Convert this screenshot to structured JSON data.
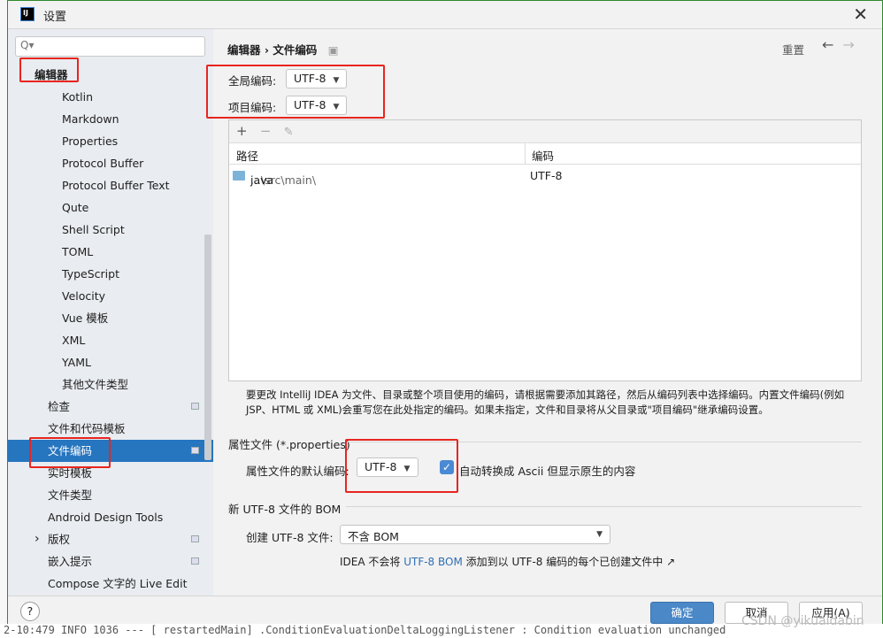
{
  "window": {
    "title": "设置",
    "logo": "IJ"
  },
  "sidebar": {
    "search_placeholder": "Q▾",
    "items": [
      {
        "label": "编辑器",
        "level": 0
      },
      {
        "label": "Kotlin",
        "level": 2
      },
      {
        "label": "Markdown",
        "level": 2
      },
      {
        "label": "Properties",
        "level": 2
      },
      {
        "label": "Protocol Buffer",
        "level": 2
      },
      {
        "label": "Protocol Buffer Text",
        "level": 2
      },
      {
        "label": "Qute",
        "level": 2
      },
      {
        "label": "Shell Script",
        "level": 2
      },
      {
        "label": "TOML",
        "level": 2
      },
      {
        "label": "TypeScript",
        "level": 2
      },
      {
        "label": "Velocity",
        "level": 2
      },
      {
        "label": "Vue 模板",
        "level": 2
      },
      {
        "label": "XML",
        "level": 2
      },
      {
        "label": "YAML",
        "level": 2
      },
      {
        "label": "其他文件类型",
        "level": 2
      },
      {
        "label": "检查",
        "level": 1
      },
      {
        "label": "文件和代码模板",
        "level": 1
      },
      {
        "label": "文件编码",
        "level": 1,
        "selected": true
      },
      {
        "label": "实时模板",
        "level": 1
      },
      {
        "label": "文件类型",
        "level": 1
      },
      {
        "label": "Android Design Tools",
        "level": 1
      },
      {
        "label": "版权",
        "level": 1,
        "expandable": true
      },
      {
        "label": "嵌入提示",
        "level": 1
      },
      {
        "label": "Compose 文字的 Live Edit",
        "level": 1
      }
    ]
  },
  "header": {
    "breadcrumb_parent": "编辑器",
    "separator": "›",
    "breadcrumb_current": "文件编码",
    "reset": "重置",
    "back": "←",
    "forward": "→"
  },
  "global_encoding": {
    "label": "全局编码:",
    "value": "UTF-8"
  },
  "project_encoding": {
    "label": "项目编码:",
    "value": "UTF-8"
  },
  "table": {
    "toolbar": [
      "+",
      "−",
      "✎"
    ],
    "columns": [
      "路径",
      "编码"
    ],
    "rows": [
      {
        "path_prefix": "...\\src\\main\\",
        "path_bold": "java",
        "encoding": "UTF-8"
      }
    ]
  },
  "description": "要更改 IntelliJ IDEA 为文件、目录或整个项目使用的编码，请根据需要添加其路径，然后从编码列表中选择编码。内置文件编码(例如JSP、HTML 或 XML)会重写您在此处指定的编码。如果未指定，文件和目录将从父目录或\"项目编码\"继承编码设置。",
  "properties": {
    "section": "属性文件 (*.properties)",
    "default_label": "属性文件的默认编码:",
    "default_value": "UTF-8",
    "ascii_checked": true,
    "ascii_label": "自动转换成 Ascii 但显示原生的内容"
  },
  "bom": {
    "section": "新 UTF-8 文件的 BOM",
    "create_label": "创建 UTF-8 文件:",
    "create_value": "不含 BOM",
    "note_pre": "IDEA 不会将 ",
    "note_link": "UTF-8 BOM",
    "note_post": " 添加到以 UTF-8 编码的每个已创建文件中 ↗"
  },
  "buttons": {
    "help": "?",
    "ok": "确定",
    "cancel": "取消",
    "apply": "应用(A)"
  },
  "watermark": "CSDN @yikuaidabin",
  "background_log": "2-10:479  INFO 1036 --- [  restartedMain] .ConditionEvaluationDeltaLoggingListener : Condition evaluation unchanged",
  "colors": {
    "selection": "#2675bf",
    "highlight_box": "#e8251f",
    "ok_button": "#4a88c7",
    "link": "#2f6fb5"
  }
}
